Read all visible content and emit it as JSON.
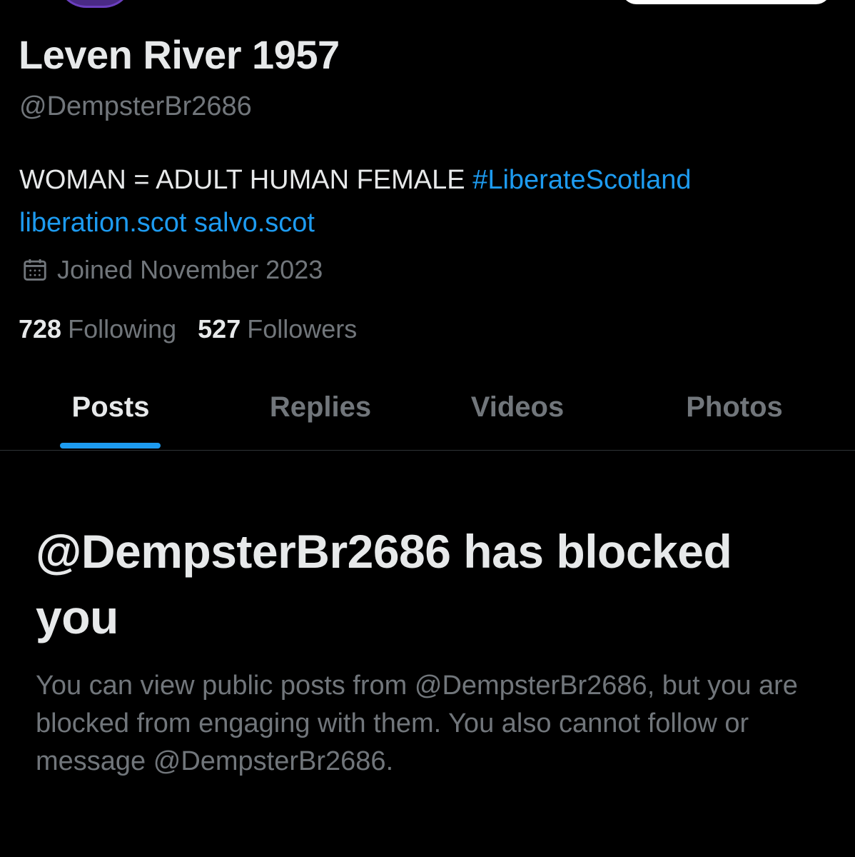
{
  "profile": {
    "display_name": "Leven River 1957",
    "handle": "@DempsterBr2686",
    "bio_text": "WOMAN = ADULT HUMAN FEMALE",
    "bio_hashtag": "#LiberateScotland",
    "bio_link_1": "liberation.scot",
    "bio_link_2": "salvo.scot",
    "joined": "Joined November 2023",
    "following_count": "728",
    "following_label": "Following",
    "followers_count": "527",
    "followers_label": "Followers"
  },
  "tabs": [
    {
      "label": "Posts",
      "active": true
    },
    {
      "label": "Replies",
      "active": false
    },
    {
      "label": "Videos",
      "active": false
    },
    {
      "label": "Photos",
      "active": false
    }
  ],
  "blocked": {
    "title": "@DempsterBr2686 has blocked you",
    "message": "You can view public posts from @DempsterBr2686, but you are blocked from engaging with them. You also cannot follow or message @DempsterBr2686."
  },
  "icons": {
    "calendar": "calendar-icon"
  },
  "colors": {
    "background": "#000000",
    "text_primary": "#e7e9ea",
    "text_secondary": "#71767b",
    "accent": "#1d9bf0",
    "divider": "#2f3336",
    "avatar_ring": "#6b3fbf"
  }
}
